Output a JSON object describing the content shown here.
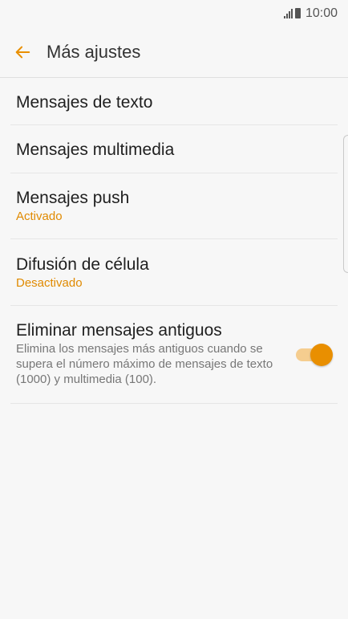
{
  "status_bar": {
    "time": "10:00",
    "signal_icon": "signal-icon",
    "battery_icon": "battery-icon"
  },
  "header": {
    "title": "Más ajustes",
    "back_icon": "back-arrow-icon"
  },
  "settings": {
    "items": [
      {
        "title": "Mensajes de texto"
      },
      {
        "title": "Mensajes multimedia"
      },
      {
        "title": "Mensajes push",
        "subtitle": "Activado"
      },
      {
        "title": "Difusión de célula",
        "subtitle": "Desactivado"
      },
      {
        "title": "Eliminar mensajes antiguos",
        "description": "Elimina los mensajes más antiguos cuando se supera el número máximo de mensajes de texto (1000) y multimedia (100).",
        "toggle_on": true
      }
    ]
  },
  "colors": {
    "accent": "#e98f00",
    "accent_light": "#f5cd8f",
    "subtitle": "#e08a00",
    "background": "#f7f7f7"
  }
}
